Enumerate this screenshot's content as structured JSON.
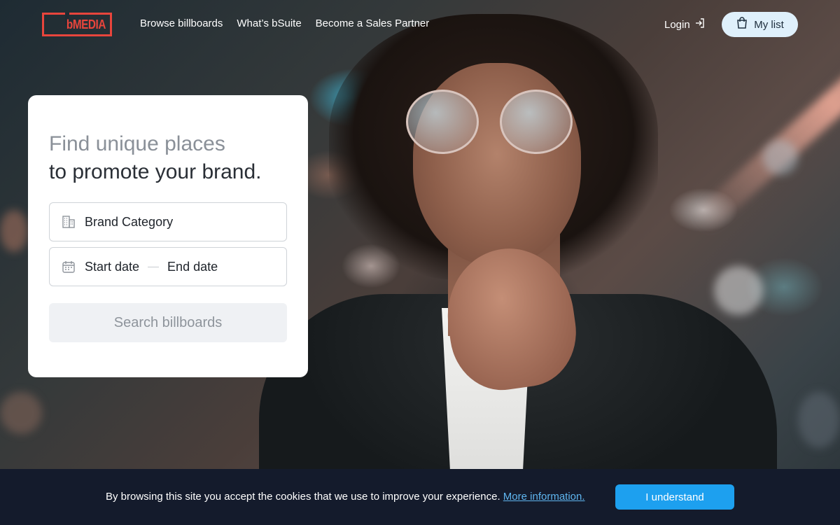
{
  "brand": {
    "logo_text": "bMEDIA",
    "accent": "#e8453c"
  },
  "nav": {
    "items": [
      {
        "label": "Browse billboards"
      },
      {
        "label": "What’s bSuite"
      },
      {
        "label": "Become a Sales Partner"
      }
    ],
    "login_label": "Login",
    "my_list_label": "My list"
  },
  "search_card": {
    "title_line1": "Find unique places",
    "title_line2": "to promote your brand.",
    "brand_category_label": "Brand Category",
    "start_date_label": "Start date",
    "end_date_label": "End date",
    "search_button_label": "Search billboards"
  },
  "cookie_bar": {
    "message": "By browsing this site you accept the cookies that we use to improve your experience.",
    "link_text": "More information.",
    "button_label": "I understand",
    "button_color": "#1da0ef",
    "background": "#141b2c"
  },
  "icons": {
    "login": "login-arrow-icon",
    "my_list": "shopping-bag-icon",
    "category": "building-icon",
    "date": "calendar-icon"
  }
}
